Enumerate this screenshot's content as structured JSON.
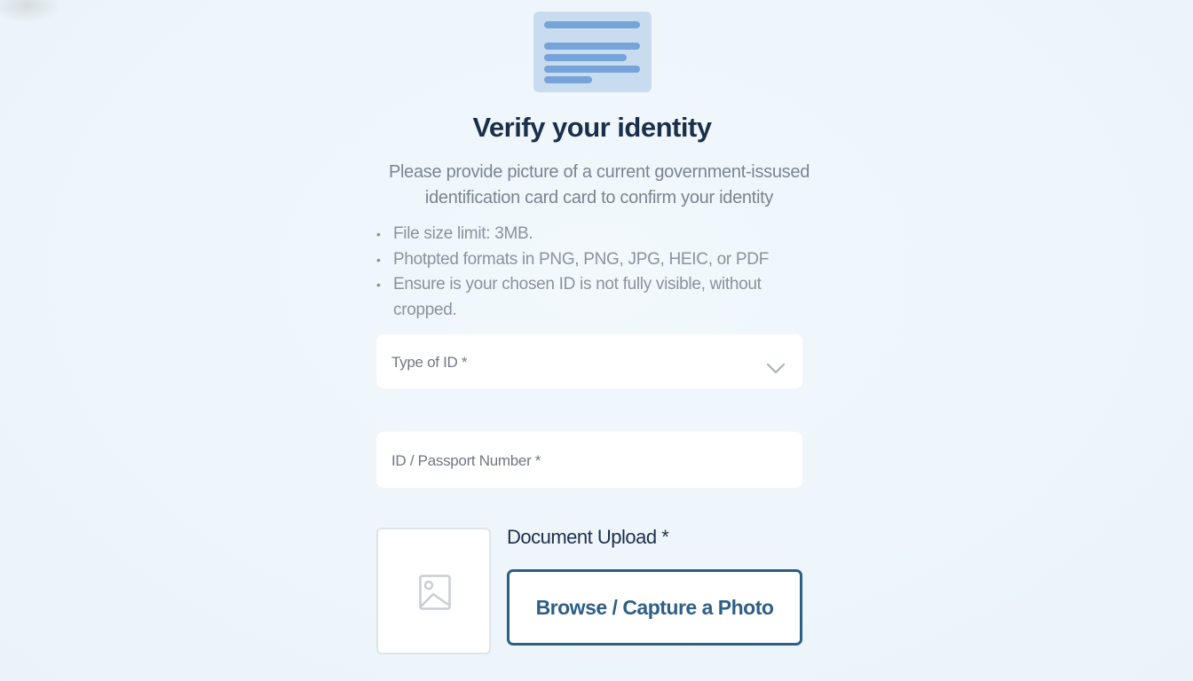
{
  "header": {
    "icon": "document-icon",
    "title": "Verify your identity",
    "subtitle": "Please provide picture of a current government-issused identification card card to confirm your identity"
  },
  "requirements": [
    "File size limit: 3MB.",
    "Photpted formats in PNG, PNG, JPG, HEIC, or PDF",
    "Ensure is your chosen ID is not fully visible, without cropped."
  ],
  "form": {
    "id_type": {
      "label": "Type of ID *",
      "icon": "chevron-down-icon"
    },
    "id_number": {
      "placeholder": "ID / Passport Number *"
    },
    "upload": {
      "label": "Document Upload *",
      "preview_icon": "image-placeholder-icon",
      "button_label": "Browse / Capture a Photo"
    }
  },
  "colors": {
    "background": "#eef6fb",
    "title": "#1c2f4a",
    "accent": "#2b5f86",
    "doc_icon_bg": "#c9dcef",
    "doc_icon_lines": "#76a3d8"
  }
}
